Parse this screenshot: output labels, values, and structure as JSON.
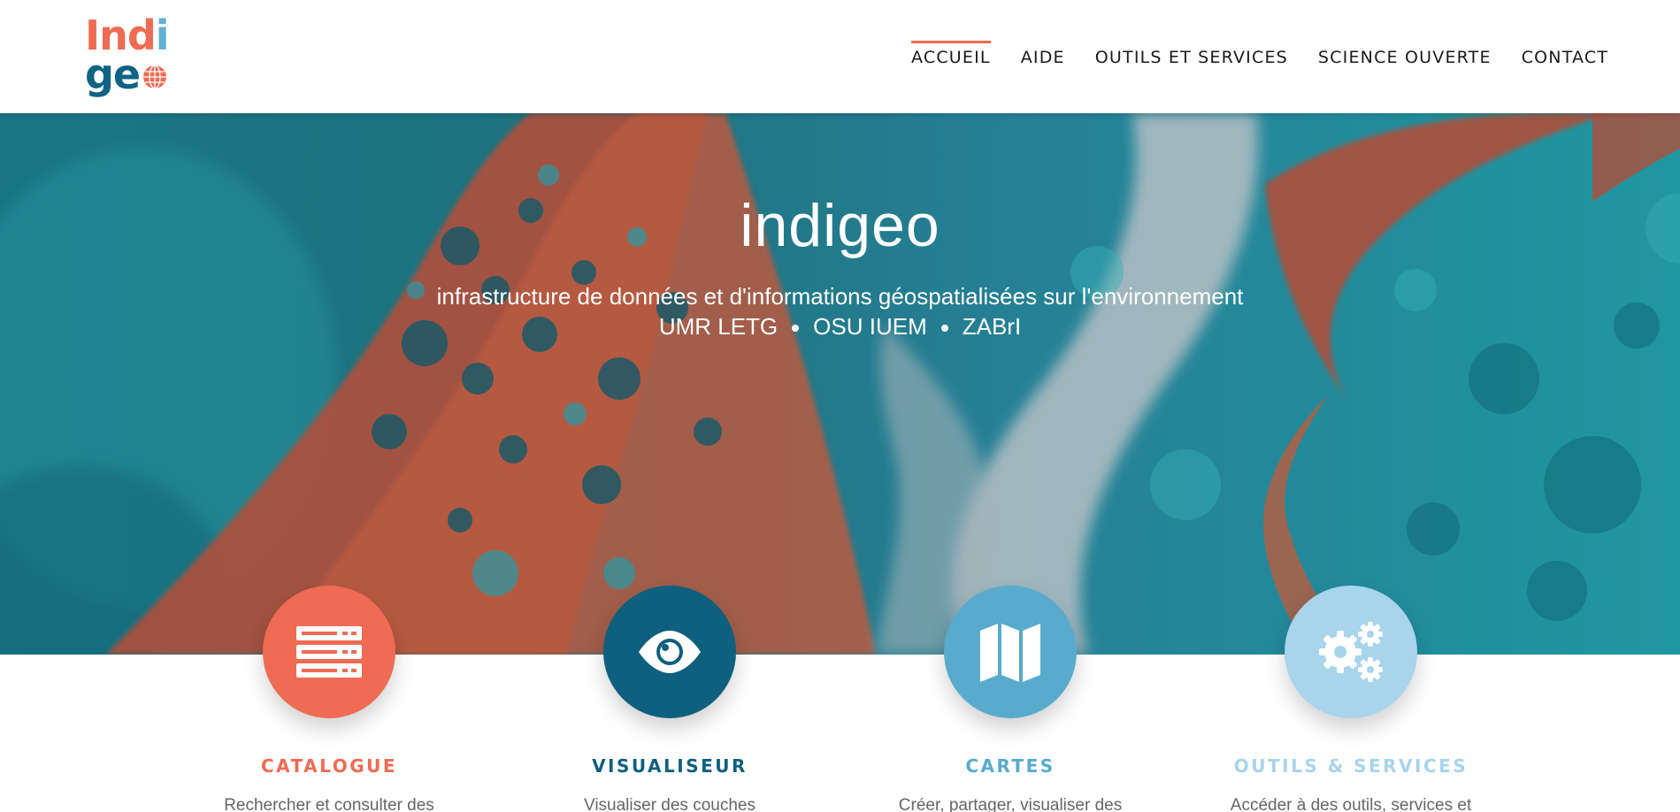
{
  "logo": {
    "line1_a": "Ind",
    "line1_b": "i",
    "line2": "ge"
  },
  "nav": {
    "items": [
      {
        "label": "ACCUEIL",
        "active": true
      },
      {
        "label": "AIDE",
        "active": false
      },
      {
        "label": "OUTILS ET SERVICES",
        "active": false
      },
      {
        "label": "SCIENCE OUVERTE",
        "active": false
      },
      {
        "label": "CONTACT",
        "active": false
      }
    ]
  },
  "hero": {
    "title": "indigeo",
    "subtitle": "infrastructure de données et d'informations géospatialisées sur l'environnement",
    "tags": [
      "UMR LETG",
      "OSU IUEM",
      "ZABrI"
    ]
  },
  "services": [
    {
      "title": "CATALOGUE",
      "description": "Rechercher et consulter des",
      "color": "#ef6b53",
      "icon": "server-icon"
    },
    {
      "title": "VISUALISEUR",
      "description": "Visualiser des couches",
      "color": "#0f5f7f",
      "icon": "eye-icon"
    },
    {
      "title": "CARTES",
      "description": "Créer, partager, visualiser des",
      "color": "#58abcc",
      "icon": "map-icon"
    },
    {
      "title": "OUTILS & SERVICES",
      "description": "Accéder à des outils, services et",
      "color": "#a8d4ec",
      "icon": "gears-icon"
    }
  ],
  "colors": {
    "accent": "#ef6b53",
    "teal": "#1f8a96",
    "navy": "#0f5f7f"
  }
}
